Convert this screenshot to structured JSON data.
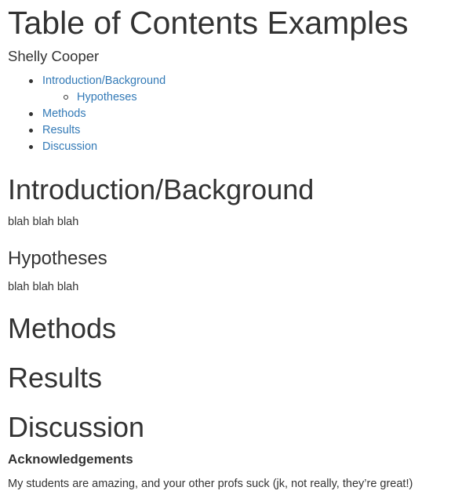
{
  "title": "Table of Contents Examples",
  "author": "Shelly Cooper",
  "toc": {
    "items": [
      {
        "label": "Introduction/Background"
      },
      {
        "label": "Hypotheses"
      },
      {
        "label": "Methods"
      },
      {
        "label": "Results"
      },
      {
        "label": "Discussion"
      }
    ]
  },
  "sections": {
    "introduction": {
      "heading": "Introduction/Background",
      "body": "blah blah blah"
    },
    "hypotheses": {
      "heading": "Hypotheses",
      "body": "blah blah blah"
    },
    "methods": {
      "heading": "Methods"
    },
    "results": {
      "heading": "Results"
    },
    "discussion": {
      "heading": "Discussion"
    },
    "acknowledgements": {
      "heading": "Acknowledgements",
      "body": "My students are amazing, and your other profs suck (jk, not really, they’re great!)"
    }
  },
  "colors": {
    "text": "#333333",
    "link": "#337ab7",
    "background": "#ffffff"
  }
}
